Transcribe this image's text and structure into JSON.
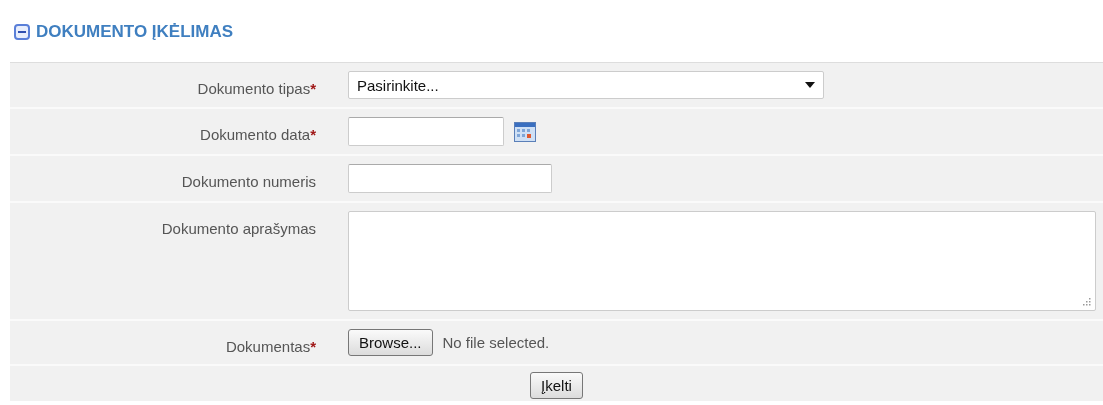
{
  "section": {
    "title": "DOKUMENTO ĮKĖLIMAS",
    "expanded": true
  },
  "fields": [
    {
      "kind": "select",
      "label": "Dokumento tipas",
      "required_mark": "*",
      "value": "Pasirinkite..."
    },
    {
      "kind": "date",
      "label": "Dokumento data",
      "required_mark": "*"
    },
    {
      "kind": "text",
      "label": "Dokumento numeris"
    },
    {
      "kind": "textarea",
      "label": "Dokumento aprašymas"
    },
    {
      "kind": "file",
      "label": "Dokumentas",
      "required_mark": "*",
      "button": "Browse...",
      "status": "No file selected."
    }
  ],
  "submit": "Įkelti"
}
